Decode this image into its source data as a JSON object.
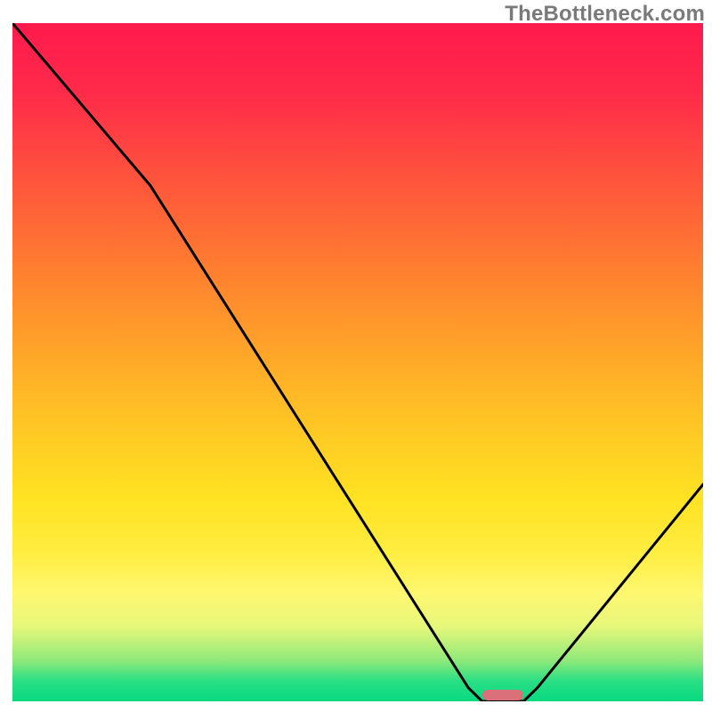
{
  "attribution": "TheBottleneck.com",
  "chart_data": {
    "type": "line",
    "title": "",
    "xlabel": "",
    "ylabel": "",
    "xlim": [
      0,
      100
    ],
    "ylim": [
      0,
      100
    ],
    "series": [
      {
        "name": "bottleneck-curve",
        "x": [
          0,
          20,
          66,
          68,
          74,
          76,
          100
        ],
        "values": [
          100,
          76,
          2,
          0,
          0,
          2,
          32
        ]
      }
    ],
    "gradient_stops": [
      {
        "pct": 0,
        "color": "#ff1a4d"
      },
      {
        "pct": 10,
        "color": "#ff2a4a"
      },
      {
        "pct": 20,
        "color": "#ff4a3f"
      },
      {
        "pct": 30,
        "color": "#ff6a35"
      },
      {
        "pct": 40,
        "color": "#ff8a2d"
      },
      {
        "pct": 50,
        "color": "#ffaa28"
      },
      {
        "pct": 60,
        "color": "#ffc824"
      },
      {
        "pct": 70,
        "color": "#ffe222"
      },
      {
        "pct": 78,
        "color": "#ffed40"
      },
      {
        "pct": 84,
        "color": "#fff770"
      },
      {
        "pct": 89,
        "color": "#e6f77a"
      },
      {
        "pct": 94,
        "color": "#8fe97a"
      },
      {
        "pct": 97,
        "color": "#2adf84"
      },
      {
        "pct": 100,
        "color": "#08d980"
      }
    ],
    "marker": {
      "x_start": 68,
      "x_end": 74,
      "y": 0,
      "color": "#d9707a"
    },
    "curve_stroke": "#000000",
    "curve_width": 3
  }
}
